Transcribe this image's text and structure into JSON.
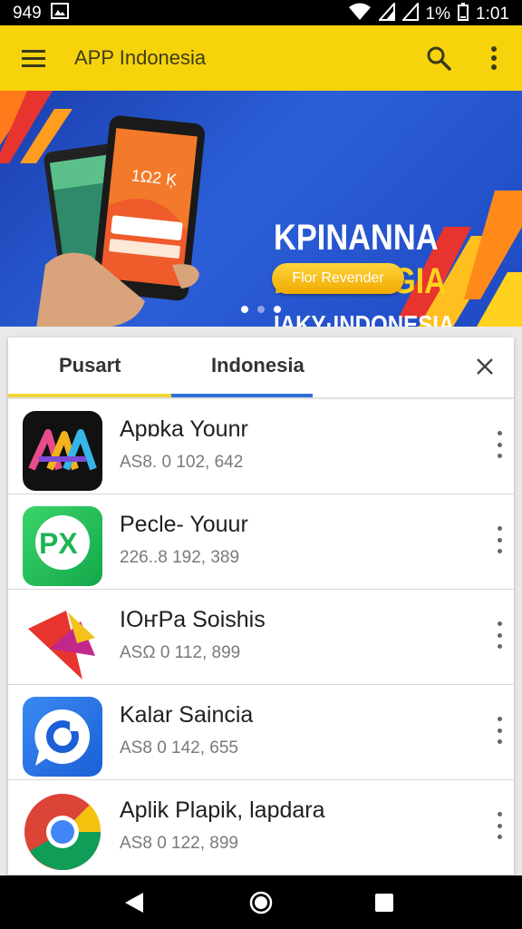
{
  "status": {
    "time_left": "949",
    "battery": "1%",
    "clock": "1:01"
  },
  "appbar": {
    "title": "APP Indonesia",
    "menu_icon": "menu-icon",
    "search_icon": "search-icon",
    "overflow_icon": "more-vert-icon"
  },
  "banner": {
    "line1": "KPINANNA",
    "line2": "INDAKNGIA",
    "line3": "IAKY·INDONESIA",
    "cta": "Flor Revender",
    "phone_time": "1Ω2 Ķ",
    "slides": 3,
    "active_slide": 3
  },
  "tabs": [
    {
      "label": "Pusart",
      "indicator_color": "#f2d43a"
    },
    {
      "label": "Indonesia",
      "indicator_color": "#2f6fd8"
    }
  ],
  "close_icon": "close-icon",
  "apps": [
    {
      "name": "Apɒka Younr",
      "meta": "AS8. 0 102, 642",
      "icon": "aa-logo-icon"
    },
    {
      "name": "Pecle- Youur",
      "meta": "226..8 192, 389",
      "icon": "px-logo-icon"
    },
    {
      "name": "IOҥPa Soishis",
      "meta": "ASΩ 0 112, 899",
      "icon": "triangle-logo-icon"
    },
    {
      "name": "Kalar Saincia",
      "meta": "AS8 0 142, 655",
      "icon": "chat-bubble-logo-icon"
    },
    {
      "name": "Aplik Plapik, lapdara",
      "meta": "AS8 0 122, 899",
      "icon": "chrome-logo-icon"
    }
  ],
  "nav": {
    "back": "back-icon",
    "home": "home-icon",
    "recents": "recents-icon"
  }
}
